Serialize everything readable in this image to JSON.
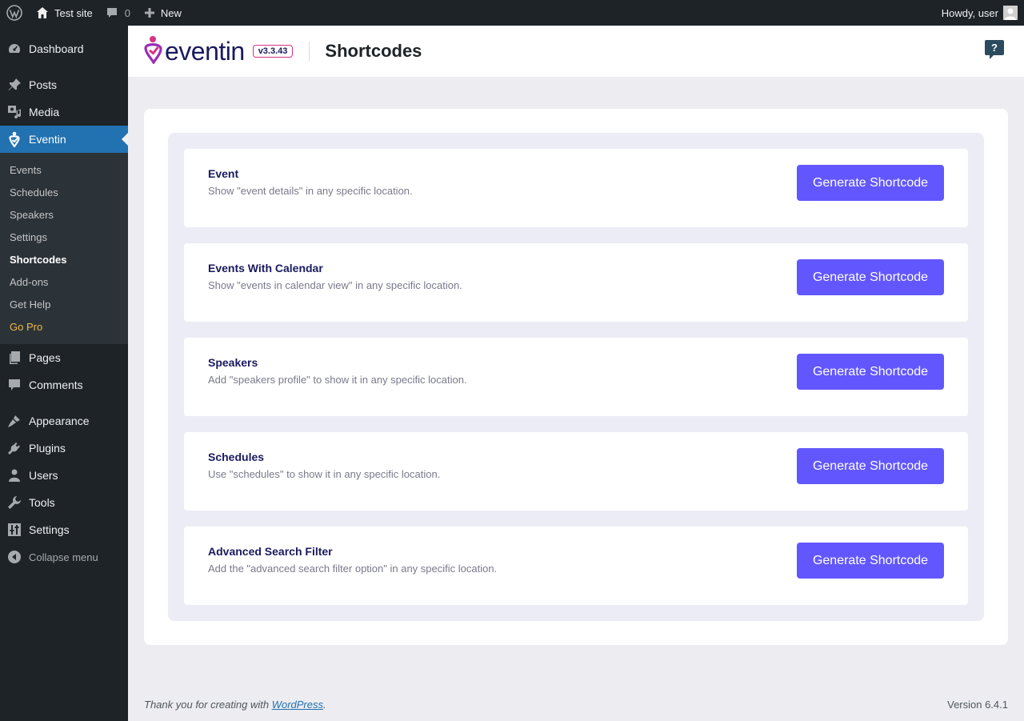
{
  "adminbar": {
    "site_name": "Test site",
    "comments_count": "0",
    "new_label": "New",
    "howdy": "Howdy, user"
  },
  "sidebar": {
    "items": [
      {
        "label": "Dashboard",
        "icon": "dashboard-icon"
      },
      {
        "label": "Posts",
        "icon": "pin-icon"
      },
      {
        "label": "Media",
        "icon": "media-icon"
      },
      {
        "label": "Eventin",
        "icon": "eventin-icon"
      },
      {
        "label": "Pages",
        "icon": "pages-icon"
      },
      {
        "label": "Comments",
        "icon": "comment-icon"
      },
      {
        "label": "Appearance",
        "icon": "brush-icon"
      },
      {
        "label": "Plugins",
        "icon": "plugin-icon"
      },
      {
        "label": "Users",
        "icon": "user-icon"
      },
      {
        "label": "Tools",
        "icon": "wrench-icon"
      },
      {
        "label": "Settings",
        "icon": "settings-icon"
      }
    ],
    "submenu": [
      "Events",
      "Schedules",
      "Speakers",
      "Settings",
      "Shortcodes",
      "Add-ons",
      "Get Help",
      "Go Pro"
    ],
    "collapse_label": "Collapse menu"
  },
  "header": {
    "logo_text": "eventin",
    "version": "v3.3.43",
    "title": "Shortcodes"
  },
  "shortcodes": [
    {
      "title": "Event",
      "desc": "Show \"event details\" in any specific location.",
      "button": "Generate Shortcode"
    },
    {
      "title": "Events With Calendar",
      "desc": "Show \"events in calendar view\" in any specific location.",
      "button": "Generate Shortcode"
    },
    {
      "title": "Speakers",
      "desc": "Add \"speakers profile\" to show it in any specific location.",
      "button": "Generate Shortcode"
    },
    {
      "title": "Schedules",
      "desc": "Use \"schedules\" to show it in any specific location.",
      "button": "Generate Shortcode"
    },
    {
      "title": "Advanced Search Filter",
      "desc": "Add the \"advanced search filter option\" in any specific location.",
      "button": "Generate Shortcode"
    }
  ],
  "footer": {
    "thanks_prefix": "Thank you for creating with ",
    "wp_link": "WordPress",
    "thanks_suffix": ".",
    "version": "Version 6.4.1"
  },
  "colors": {
    "accent": "#6257ff",
    "wp_blue": "#2271b1",
    "gopro": "#f0b849",
    "brand_pink": "#d63384"
  }
}
